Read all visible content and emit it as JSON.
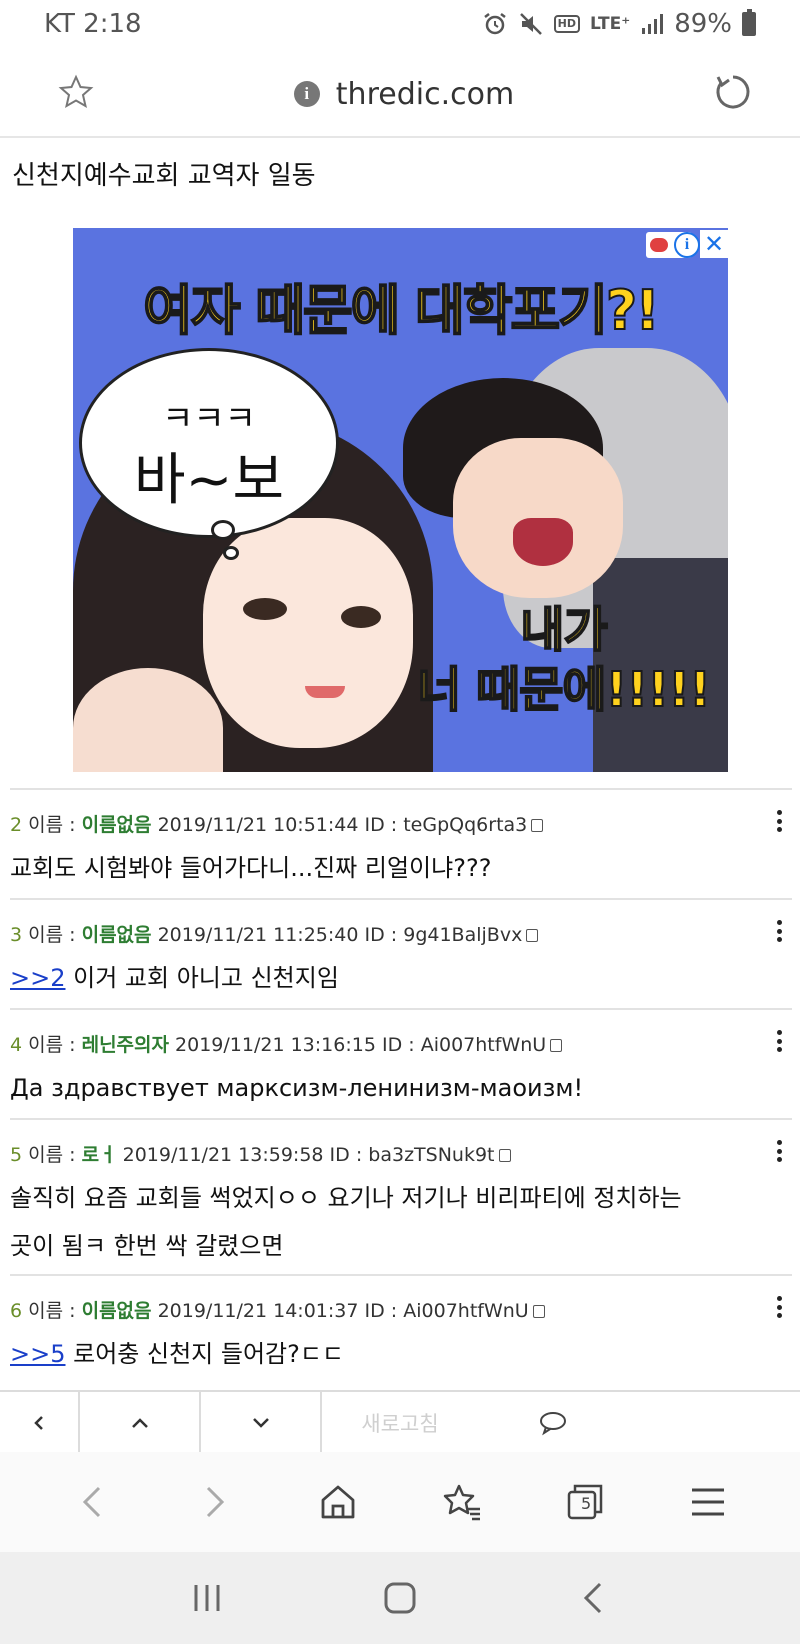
{
  "status_bar": {
    "carrier_time": "KT 2:18",
    "hd_label": "HD",
    "lte_label": "LTE⁺",
    "battery": "89%"
  },
  "address_bar": {
    "url": "thredic.com"
  },
  "page_title": "신천지예수교회 교역자 일동",
  "ad": {
    "headline": "여자 때문에 대학포기?!",
    "bubble_line1": "ㅋㅋㅋ",
    "bubble_line2": "바~보",
    "sub_line1": "내가",
    "sub_line2": "너 때문에!!!!!",
    "info_glyph": "i",
    "close_glyph": "✕"
  },
  "posts": [
    {
      "num": "2",
      "name_label": "이름 :",
      "name": "이름없음",
      "datetime": "2019/11/21 10:51:44",
      "id_label": "ID :",
      "id": "teGpQq6rta3",
      "link": "",
      "text": "교회도 시험봐야 들어가다니...진짜 리얼이냐???"
    },
    {
      "num": "3",
      "name_label": "이름 :",
      "name": "이름없음",
      "datetime": "2019/11/21 11:25:40",
      "id_label": "ID :",
      "id": "9g41BaljBvx",
      "link": ">>2",
      "text": " 이거 교회 아니고 신천지임"
    },
    {
      "num": "4",
      "name_label": "이름 :",
      "name": "레닌주의자",
      "datetime": "2019/11/21 13:16:15",
      "id_label": "ID :",
      "id": "Ai007htfWnU",
      "link": "",
      "text": "Да здравствует марксизм-ленинизм-маоизм!"
    },
    {
      "num": "5",
      "name_label": "이름 :",
      "name": "로ㅓ",
      "datetime": "2019/11/21 13:59:58",
      "id_label": "ID :",
      "id": "ba3zTSNuk9t",
      "link": "",
      "text": "솔직히 요즘 교회들 썩었지ㅇㅇ 요기나 저기나 비리파티에 정치하는",
      "text2": "곳이 됨ㅋ 한번 싹 갈렸으면"
    },
    {
      "num": "6",
      "name_label": "이름 :",
      "name": "이름없음",
      "datetime": "2019/11/21 14:01:37",
      "id_label": "ID :",
      "id": "Ai007htfWnU",
      "link": ">>5",
      "text": " 로어충 신천지 들어감?ㄷㄷ"
    }
  ],
  "thread_toolbar": {
    "back_glyph": "‹",
    "up_glyph": "︿",
    "down_glyph": "﹀",
    "refresh_label": "새로고침"
  },
  "browser_nav": {
    "tab_count": "5"
  },
  "colors": {
    "name_green": "#2e7d32",
    "link_blue": "#1a3fc9",
    "ad_blue": "#5a73e0",
    "ad_yellow": "#ffd21e"
  }
}
